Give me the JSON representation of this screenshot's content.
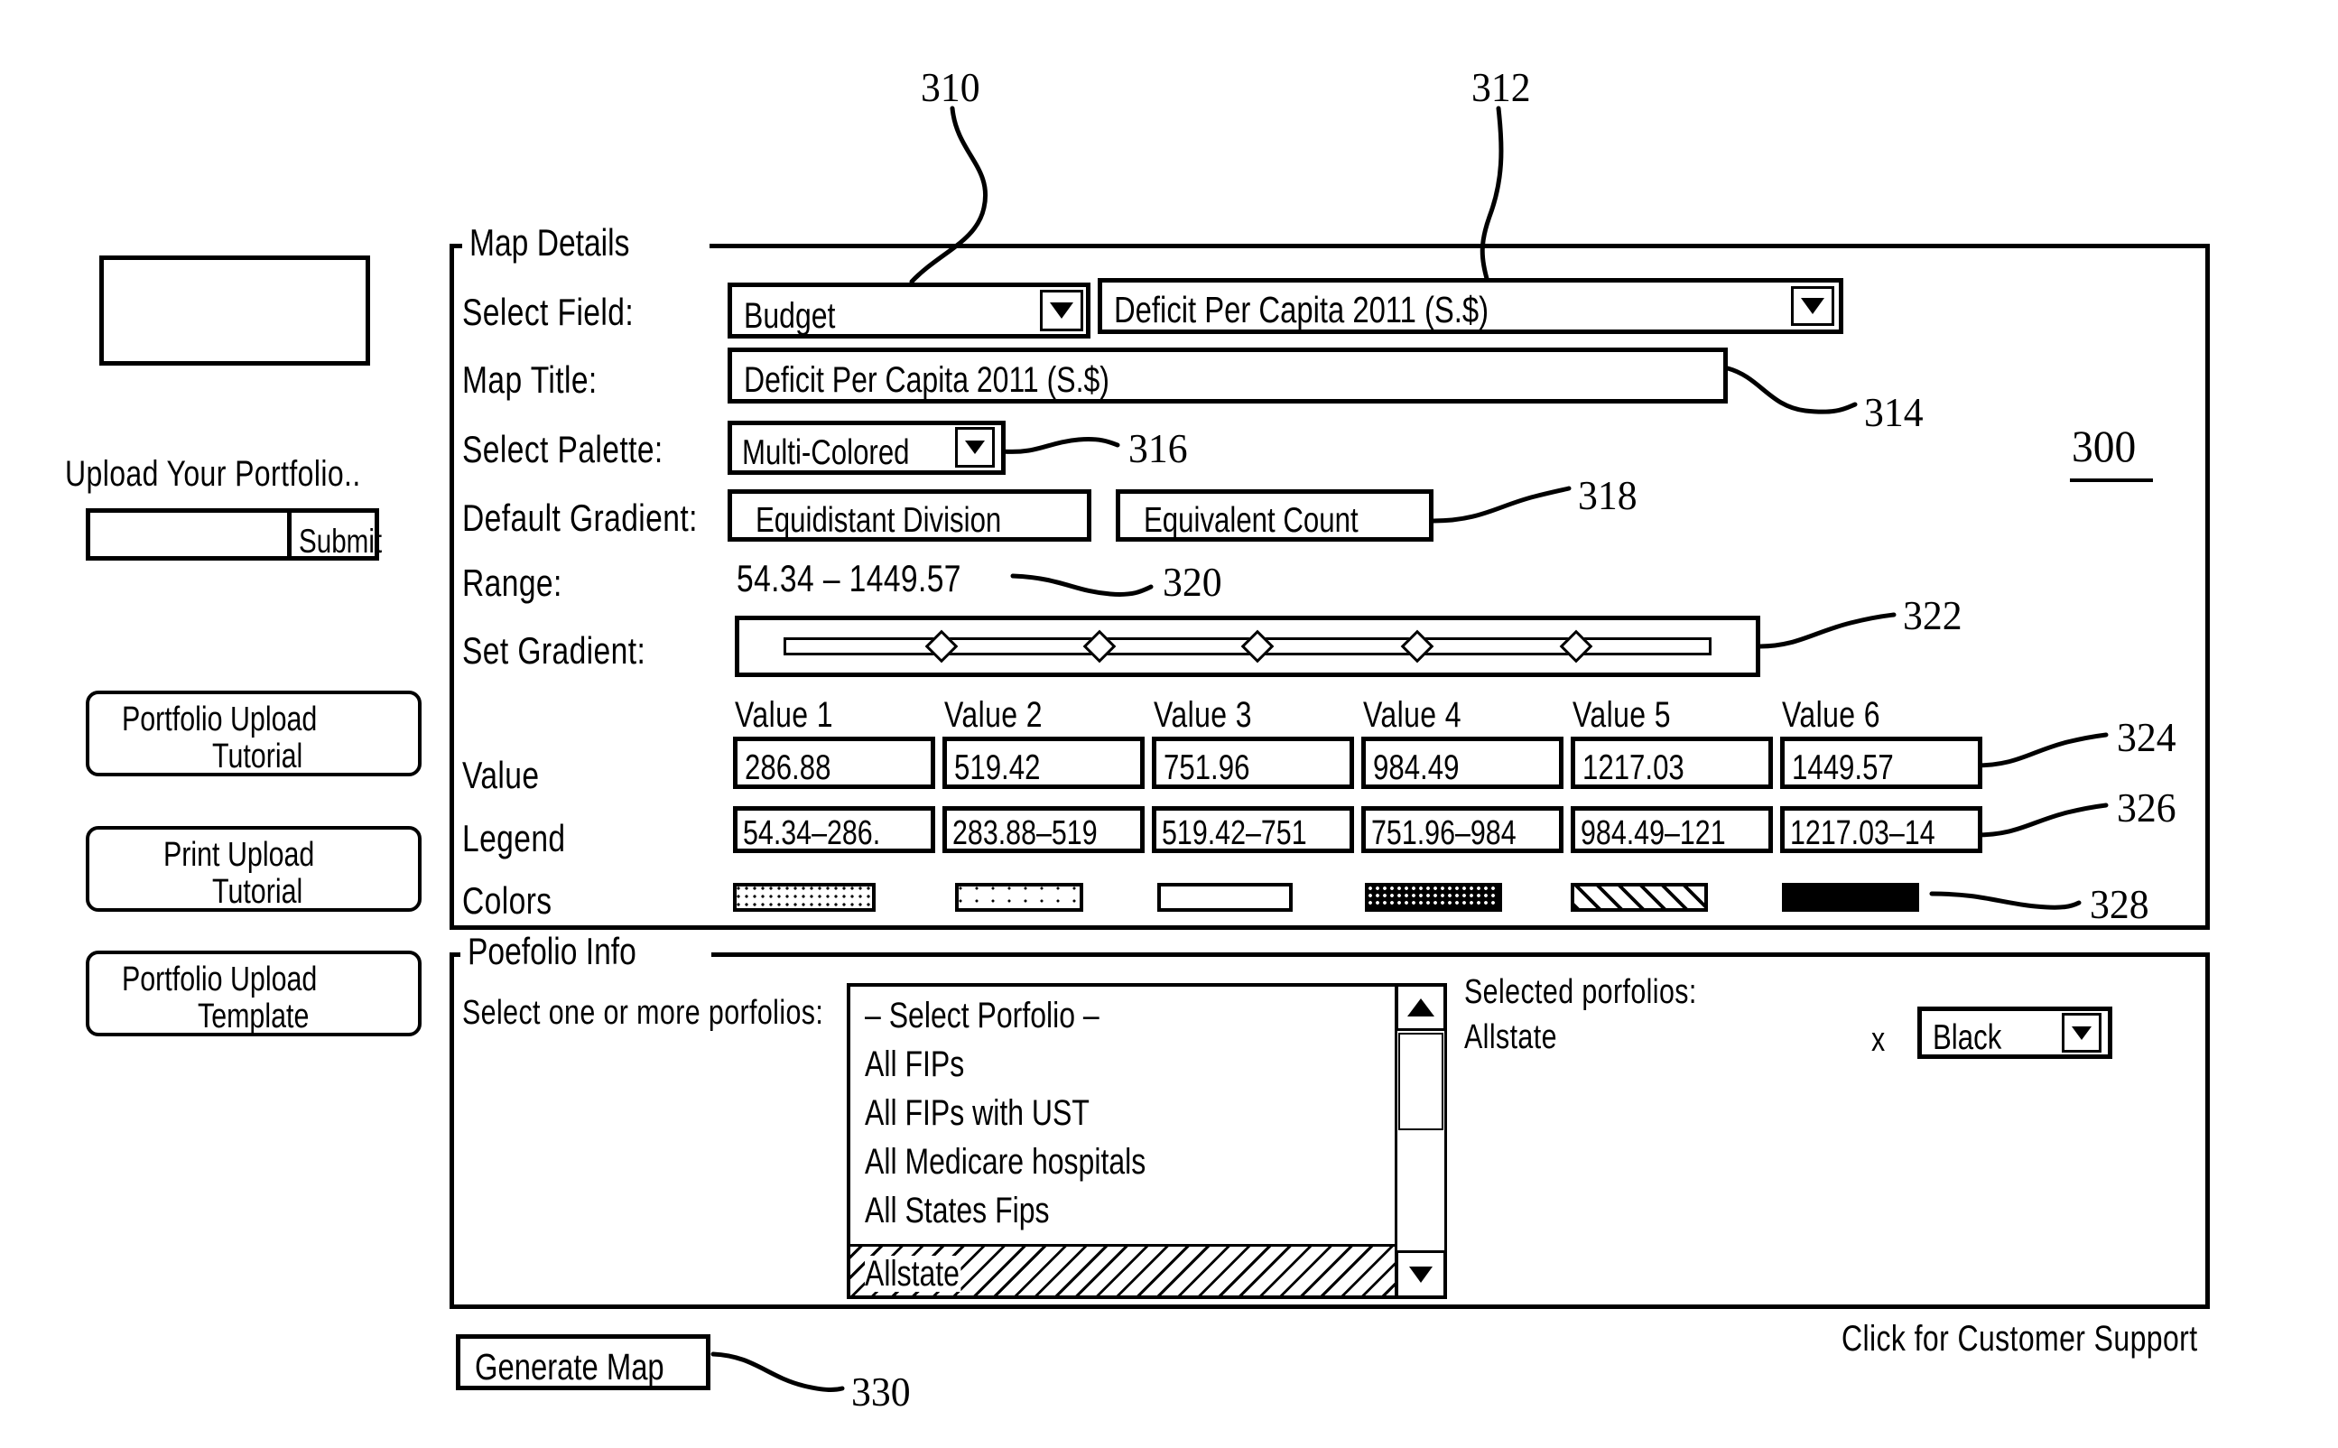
{
  "figure": {
    "label_300": "300",
    "ref_310": "310",
    "ref_312": "312",
    "ref_314": "314",
    "ref_316": "316",
    "ref_318": "318",
    "ref_320": "320",
    "ref_322": "322",
    "ref_324": "324",
    "ref_326": "326",
    "ref_328": "328",
    "ref_330": "330"
  },
  "sidebar": {
    "logo_placeholder": "",
    "upload_label": "Upload Your Portfolio..",
    "upload_input_value": "",
    "submit_label": "Submit",
    "buttons": [
      {
        "line1": "Portfolio Upload",
        "line2": "Tutorial"
      },
      {
        "line1": "Print Upload",
        "line2": "Tutorial"
      },
      {
        "line1": "Portfolio Upload",
        "line2": "Template"
      }
    ]
  },
  "map_details": {
    "group_title": "Map Details",
    "select_field_label": "Select Field:",
    "field_category_value": "Budget",
    "field_name_value": "Deficit Per Capita 2011 (S.$)",
    "map_title_label": "Map Title:",
    "map_title_value": "Deficit Per Capita 2011 (S.$)",
    "select_palette_label": "Select Palette:",
    "palette_value": "Multi-Colored",
    "default_gradient_label": "Default Gradient:",
    "gradient_equidistant_label": "Equidistant Division",
    "gradient_equivalent_label": "Equivalent Count",
    "range_label": "Range:",
    "range_value": "54.34 – 1449.57",
    "set_gradient_label": "Set Gradient:",
    "value_row_label": "Value",
    "legend_row_label": "Legend",
    "colors_row_label": "Colors",
    "columns": [
      {
        "header": "Value 1",
        "value": "286.88",
        "legend": "54.34–286.",
        "color": "dots-dense"
      },
      {
        "header": "Value 2",
        "value": "519.42",
        "legend": "283.88–519",
        "color": "dots-sparse"
      },
      {
        "header": "Value 3",
        "value": "751.96",
        "legend": "519.42–751",
        "color": "empty"
      },
      {
        "header": "Value 4",
        "value": "984.49",
        "legend": "751.96–984",
        "color": "dots-verydense"
      },
      {
        "header": "Value 5",
        "value": "1217.03",
        "legend": "984.49–121",
        "color": "hatch"
      },
      {
        "header": "Value 6",
        "value": "1449.57",
        "legend": "1217.03–14",
        "color": "solid"
      }
    ]
  },
  "portfolio_info": {
    "group_title": "Poefolio Info",
    "select_label": "Select one or more porfolios:",
    "list_items": [
      "– Select Porfolio –",
      "All FIPs",
      "All FIPs with UST",
      "All Medicare hospitals",
      "All States Fips"
    ],
    "selected_list_item": "Allstate",
    "selected_label": "Selected porfolios:",
    "selected_value": "Allstate",
    "remove_label": "x",
    "color_select_value": "Black"
  },
  "footer": {
    "generate_map_label": "Generate Map",
    "customer_support_label": "Click for Customer Support"
  }
}
